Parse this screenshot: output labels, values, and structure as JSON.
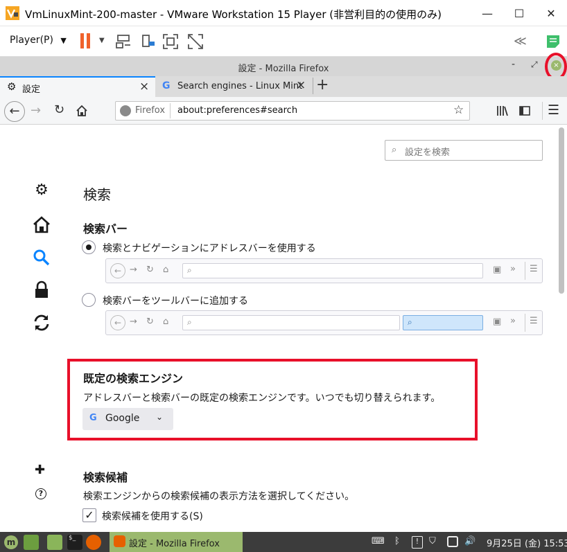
{
  "vm": {
    "window_title": "VmLinuxMint-200-master - VMware Workstation 15 Player (非営利目的の使用のみ)",
    "minimize": "—",
    "maximize": "☐",
    "close": "✕",
    "player_menu": "Player(P)",
    "brand_color": "#f0622b"
  },
  "mint_window": {
    "title": "設定 - Mozilla Firefox",
    "minimize": "-",
    "maximize": "⤢"
  },
  "tabs": [
    {
      "label": "設定",
      "active": true
    },
    {
      "label": "Search engines - Linux Mint",
      "active": false
    }
  ],
  "tab_close": "×",
  "new_tab": "+",
  "urlbar": {
    "identity": "Firefox",
    "url": "about:preferences#search"
  },
  "prefs": {
    "search_placeholder": "設定を検索",
    "page_title": "検索",
    "searchbar_heading": "検索バー",
    "option_urlbar": "検索とナビゲーションにアドレスバーを使用する",
    "option_toolbar": "検索バーをツールバーに追加する",
    "default_engine_heading": "既定の検索エンジン",
    "default_engine_desc": "アドレスバーと検索バーの既定の検索エンジンです。いつでも切り替えられます。",
    "default_engine_value": "Google",
    "suggestions_heading": "検索候補",
    "suggestions_desc": "検索エンジンからの検索候補の表示方法を選択してください。",
    "suggestions_checkbox": "検索候補を使用する(S)",
    "accent_color": "#0a84ff",
    "highlight_color": "#e8102a"
  },
  "taskbar": {
    "active_task": "設定 - Mozilla Firefox",
    "clock": "9月25日 (金) 15:53",
    "active_color": "#9bb96e"
  }
}
